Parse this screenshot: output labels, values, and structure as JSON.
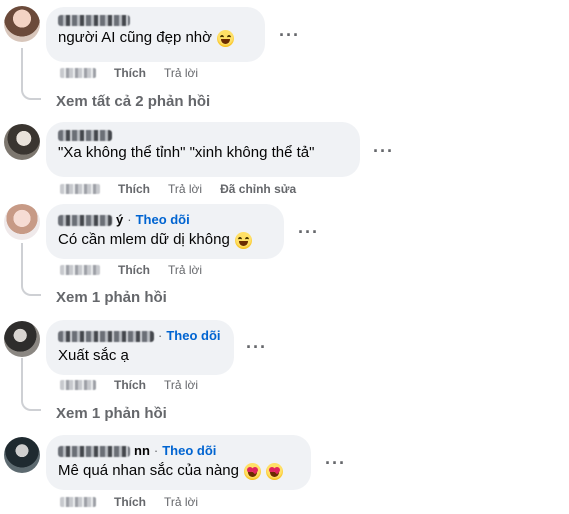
{
  "comments": [
    {
      "author_visible": "",
      "follow_label": "",
      "text": "người AI cũng đẹp nhờ",
      "emoji": "grin",
      "actions": {
        "like": "Thích",
        "reply": "Trả lời",
        "edited": ""
      },
      "view_replies": "Xem tất cả 2 phản hồi"
    },
    {
      "author_visible": "",
      "follow_label": "",
      "text": "\"Xa không thể tỉnh\" \"xinh không thể tả\"",
      "emoji": "",
      "actions": {
        "like": "Thích",
        "reply": "Trả lời",
        "edited": "Đã chỉnh sửa"
      },
      "view_replies": ""
    },
    {
      "author_visible": "ý",
      "follow_label": "Theo dõi",
      "text": "Có cần mlem dữ dị không",
      "emoji": "grin",
      "actions": {
        "like": "Thích",
        "reply": "Trả lời",
        "edited": ""
      },
      "view_replies": "Xem 1 phản hồi"
    },
    {
      "author_visible": "",
      "follow_label": "Theo dõi",
      "text": "Xuất sắc ạ",
      "emoji": "",
      "actions": {
        "like": "Thích",
        "reply": "Trả lời",
        "edited": ""
      },
      "view_replies": "Xem 1 phản hồi"
    },
    {
      "author_visible": "nn",
      "follow_label": "Theo dõi",
      "text": "Mê quá nhan sắc của nàng",
      "emoji": "heart-eyes",
      "actions": {
        "like": "Thích",
        "reply": "Trả lời",
        "edited": ""
      },
      "view_replies": ""
    }
  ],
  "icons": {
    "more": "more-options-icon",
    "avatar": "avatar"
  },
  "colors": {
    "bubble": "#f0f2f5",
    "follow": "#0064d1",
    "muted": "#65676b"
  }
}
